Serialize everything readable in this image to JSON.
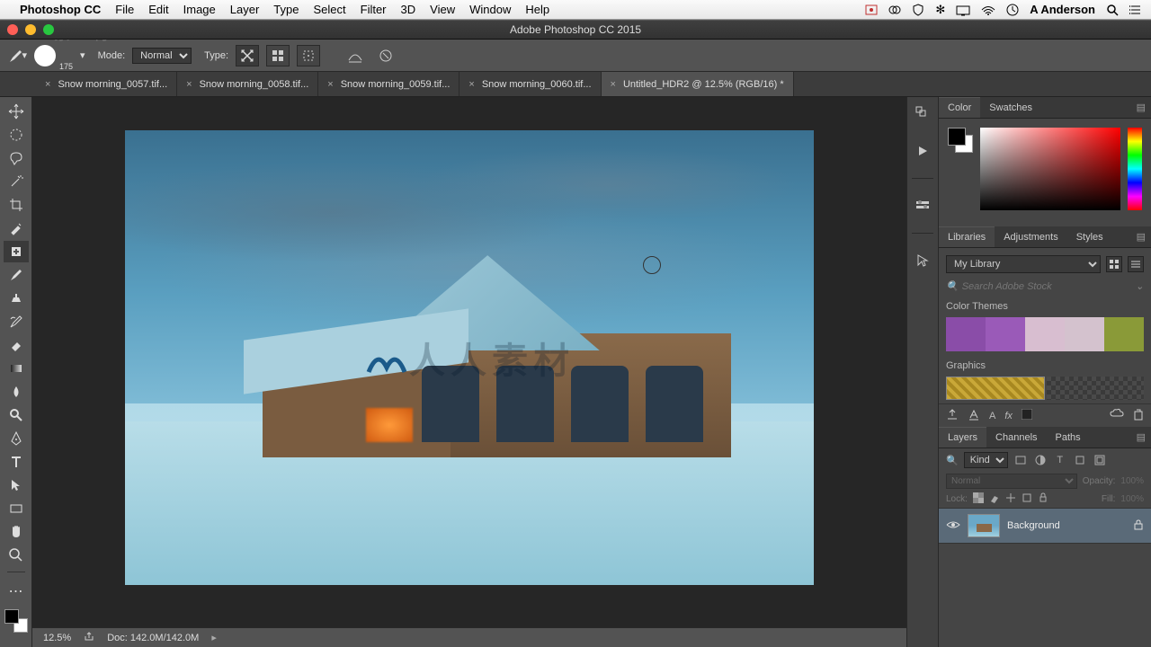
{
  "mac_menu": {
    "app": "Photoshop CC",
    "items": [
      "File",
      "Edit",
      "Image",
      "Layer",
      "Type",
      "Select",
      "Filter",
      "3D",
      "View",
      "Window",
      "Help"
    ],
    "user": "A Anderson"
  },
  "window": {
    "title": "Adobe Photoshop CC 2015"
  },
  "options": {
    "brush_size": "175",
    "mode_label": "Mode:",
    "mode_value": "Normal",
    "type_label": "Type:"
  },
  "tabs": [
    {
      "label": "Snow morning_0057.tif...",
      "active": false
    },
    {
      "label": "Snow morning_0058.tif...",
      "active": false
    },
    {
      "label": "Snow morning_0059.tif...",
      "active": false
    },
    {
      "label": "Snow morning_0060.tif...",
      "active": false
    },
    {
      "label": "Untitled_HDR2 @ 12.5% (RGB/16) *",
      "active": true
    }
  ],
  "status": {
    "zoom": "12.5%",
    "doc": "Doc: 142.0M/142.0M"
  },
  "panels": {
    "color_tabs": [
      "Color",
      "Swatches"
    ],
    "lib_tabs": [
      "Libraries",
      "Adjustments",
      "Styles"
    ],
    "library_select": "My Library",
    "search_placeholder": "Search Adobe Stock",
    "section_colorthemes": "Color Themes",
    "section_graphics": "Graphics",
    "theme_colors": [
      "#8a4da8",
      "#9a5ab8",
      "#d8bed0",
      "#d4c2ce",
      "#8a9a38"
    ],
    "layers_tabs": [
      "Layers",
      "Channels",
      "Paths"
    ],
    "kind": "Kind",
    "blend": "Normal",
    "opacity_label": "Opacity:",
    "opacity_value": "100%",
    "lock_label": "Lock:",
    "fill_label": "Fill:",
    "fill_value": "100%",
    "layer_name": "Background"
  },
  "watermark": "人人素材",
  "stray_text": "素 材"
}
